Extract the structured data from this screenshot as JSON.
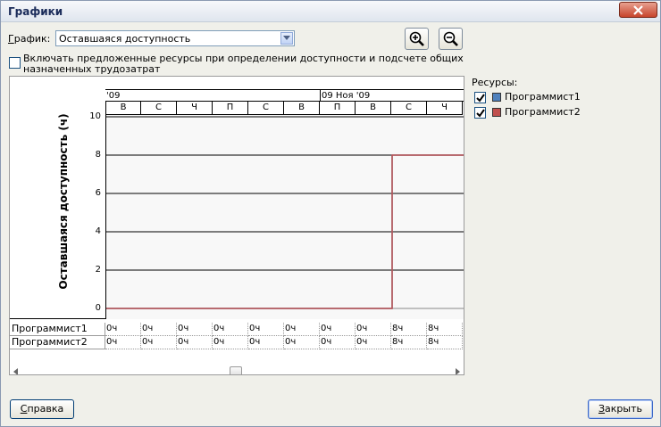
{
  "window": {
    "title": "Графики"
  },
  "graph": {
    "label_hotkey": "Г",
    "label_rest": "рафик:",
    "selected": "Оставшаяся доступность"
  },
  "include": {
    "line1": "Включать предложенные ресурсы при определении доступности и подсчете общих",
    "line2": "назначенных трудозатрат",
    "checked": false
  },
  "timeline": {
    "top": [
      {
        "label": "'09"
      },
      {
        "label": "09 Ноя '09"
      }
    ],
    "days": [
      "В",
      "С",
      "Ч",
      "П",
      "С",
      "В",
      "П",
      "В",
      "С",
      "Ч"
    ]
  },
  "chart_data": {
    "type": "line",
    "ylabel": "Оставшаяся доступность (ч)",
    "ylim": [
      0,
      10
    ],
    "yticks": [
      "10",
      "8",
      "6",
      "4",
      "2",
      "0"
    ],
    "categories": [
      "В",
      "С",
      "Ч",
      "П",
      "С",
      "В",
      "П",
      "В",
      "С",
      "Ч"
    ],
    "series": [
      {
        "name": "Программист1",
        "color": "#4f81bd",
        "values": [
          0,
          0,
          0,
          0,
          0,
          0,
          0,
          0,
          8,
          8
        ]
      },
      {
        "name": "Программист2",
        "color": "#c0504d",
        "values": [
          0,
          0,
          0,
          0,
          0,
          0,
          0,
          0,
          8,
          8
        ]
      }
    ],
    "grid": true
  },
  "table": {
    "rows": [
      {
        "name": "Программист1",
        "cells": [
          "0ч",
          "0ч",
          "0ч",
          "0ч",
          "0ч",
          "0ч",
          "0ч",
          "0ч",
          "8ч",
          "8ч"
        ]
      },
      {
        "name": "Программист2",
        "cells": [
          "0ч",
          "0ч",
          "0ч",
          "0ч",
          "0ч",
          "0ч",
          "0ч",
          "0ч",
          "8ч",
          "8ч"
        ]
      }
    ]
  },
  "resources": {
    "title": "Ресурсы:",
    "items": [
      {
        "name": "Программист1",
        "color": "#4f81bd",
        "checked": true
      },
      {
        "name": "Программист2",
        "color": "#c0504d",
        "checked": true
      }
    ]
  },
  "buttons": {
    "help_hotkey": "С",
    "help_rest": "правка",
    "close_hotkey": "З",
    "close_rest": "акрыть"
  },
  "icons": [
    "close-icon",
    "dropdown-arrow-icon",
    "zoom-in-icon",
    "zoom-out-icon",
    "checkmark-icon"
  ]
}
